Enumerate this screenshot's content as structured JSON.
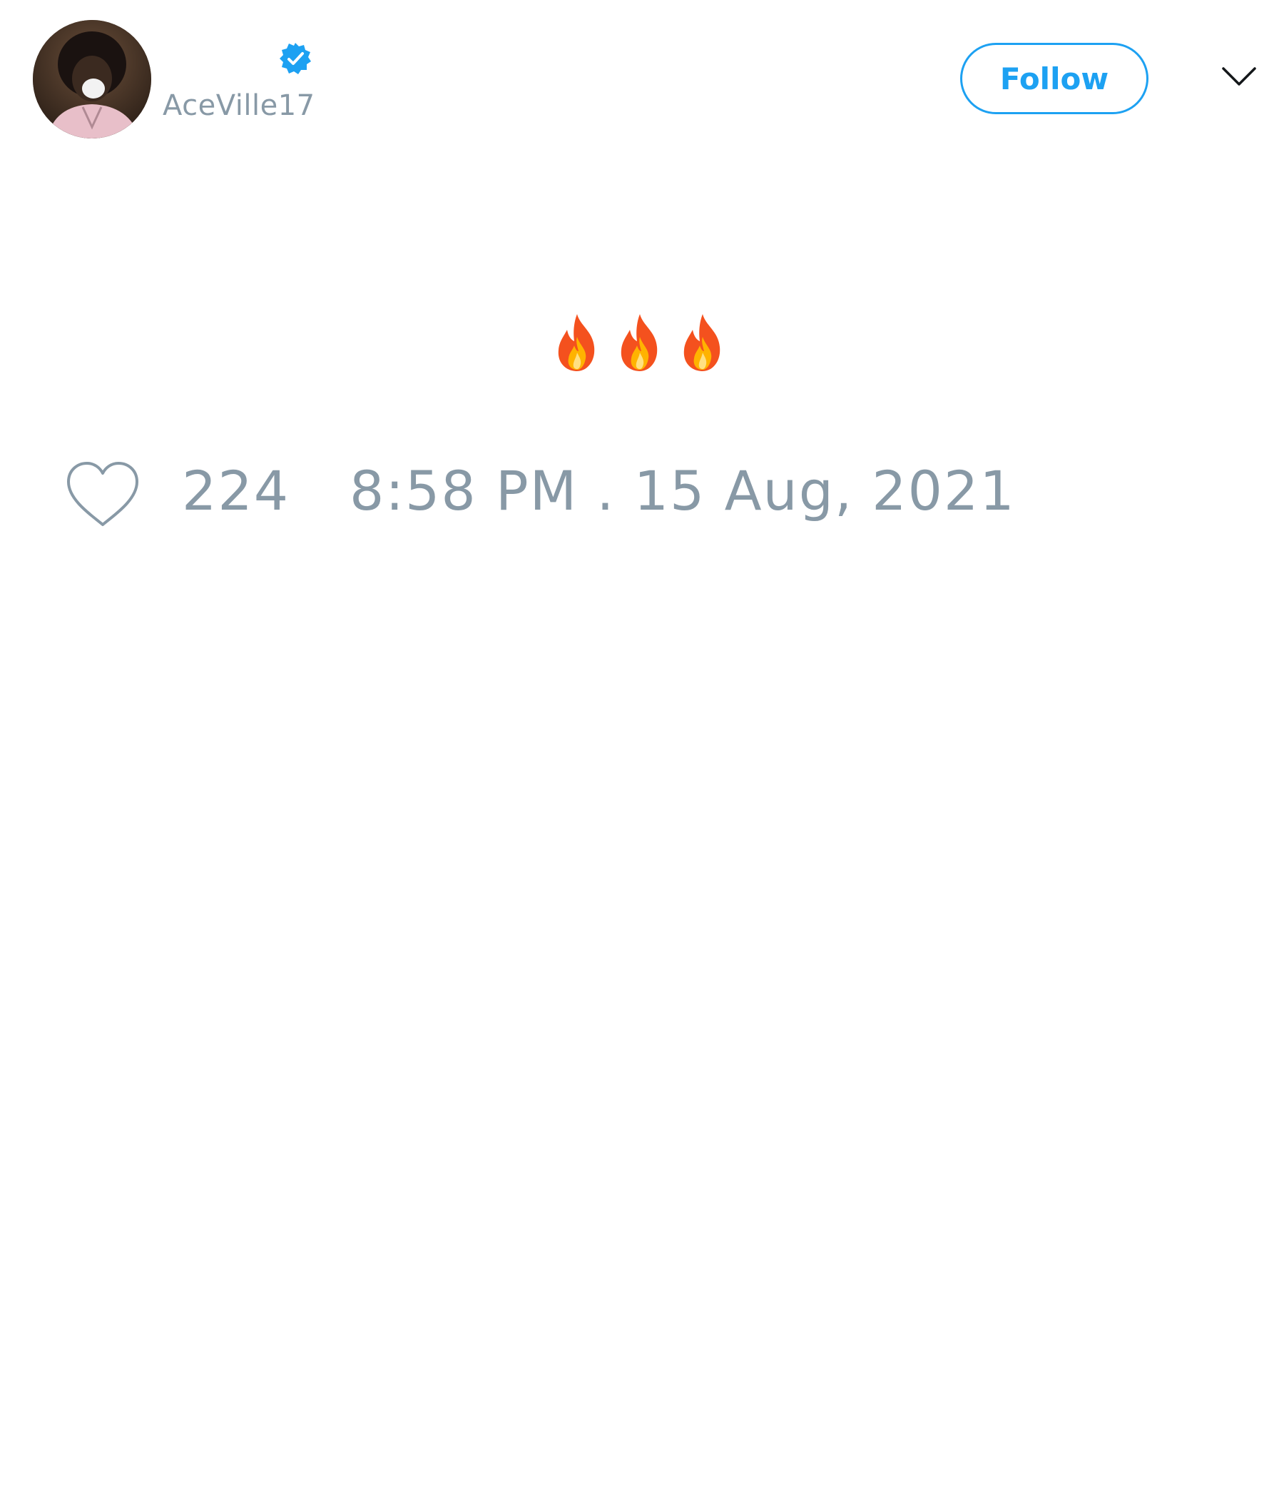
{
  "user": {
    "handle": "AceVille17",
    "verified": true
  },
  "actions": {
    "follow_label": "Follow"
  },
  "tweet": {
    "text": "🔥🔥🔥",
    "emoji_names": [
      "fire-emoji",
      "fire-emoji",
      "fire-emoji"
    ]
  },
  "stats": {
    "likes": "224",
    "timestamp": "8:58 PM . 15 Aug, 2021"
  },
  "colors": {
    "accent": "#1da1f2",
    "muted_text": "#8899a6",
    "verified_badge": "#1da1f2",
    "fire_outer": "#f4511e",
    "fire_inner": "#ffb300"
  },
  "icons": {
    "verified": "verified-badge-icon",
    "chevron": "chevron-down-icon",
    "like": "heart-outline-icon"
  }
}
